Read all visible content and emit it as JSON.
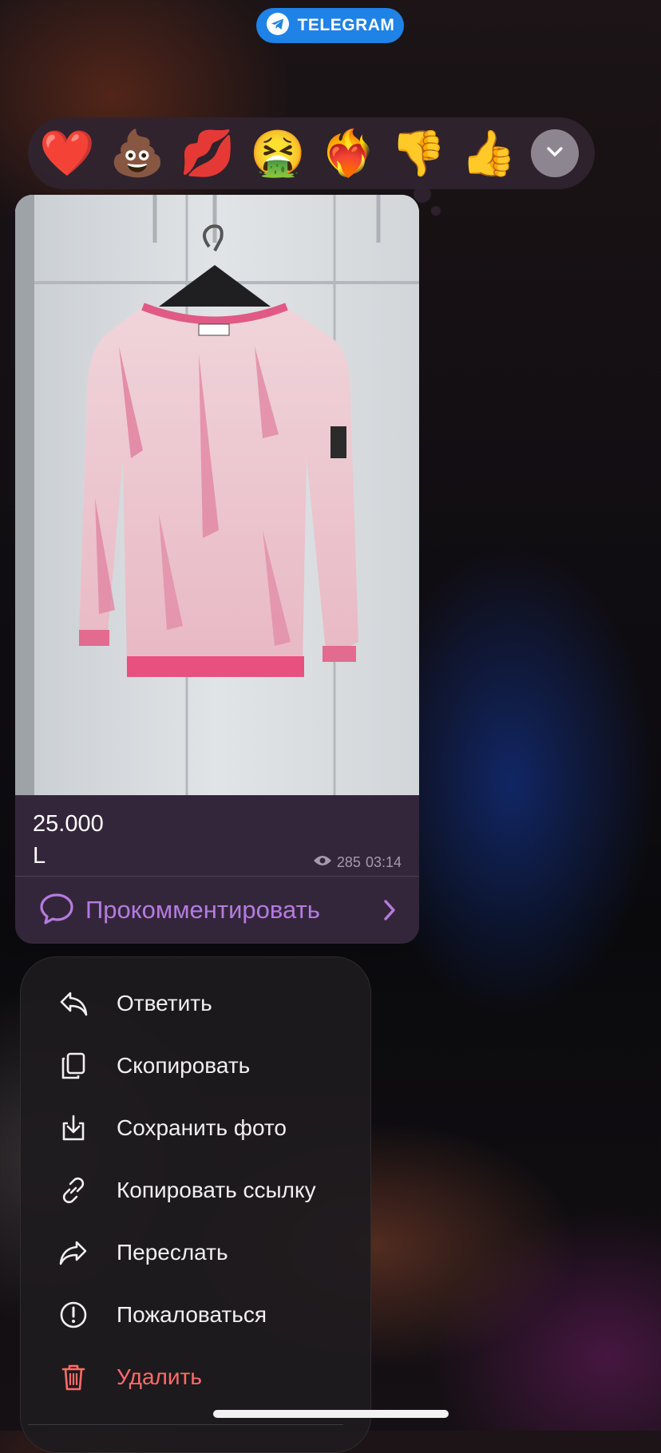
{
  "source_pill": {
    "label": "TELEGRAM",
    "icon": "telegram-plane-icon",
    "color": "#1f82e6"
  },
  "reactions": [
    {
      "emoji": "❤️",
      "name": "red-heart"
    },
    {
      "emoji": "💩",
      "name": "pile-of-poo"
    },
    {
      "emoji": "💋",
      "name": "kiss-mark"
    },
    {
      "emoji": "🤮",
      "name": "vomiting-face"
    },
    {
      "emoji": "❤️‍🔥",
      "name": "heart-on-fire"
    },
    {
      "emoji": "👎",
      "name": "thumbs-down"
    },
    {
      "emoji": "👍",
      "name": "thumbs-up"
    }
  ],
  "message": {
    "photo_description": "pink tie-dye sweatshirt on hanger",
    "caption_lines": [
      "25.000",
      "L"
    ],
    "views": "285",
    "time": "03:14",
    "comment_label": "Прокомментировать",
    "accent_color": "#b57be0"
  },
  "context_menu": {
    "items": [
      {
        "label": "Ответить",
        "icon": "reply-icon",
        "danger": false
      },
      {
        "label": "Скопировать",
        "icon": "copy-icon",
        "danger": false
      },
      {
        "label": "Сохранить фото",
        "icon": "save-download-icon",
        "danger": false
      },
      {
        "label": "Копировать ссылку",
        "icon": "link-icon",
        "danger": false
      },
      {
        "label": "Переслать",
        "icon": "forward-icon",
        "danger": false
      },
      {
        "label": "Пожаловаться",
        "icon": "report-exclamation-icon",
        "danger": false
      },
      {
        "label": "Удалить",
        "icon": "trash-icon",
        "danger": true
      }
    ],
    "danger_color": "#ff6b6b"
  }
}
